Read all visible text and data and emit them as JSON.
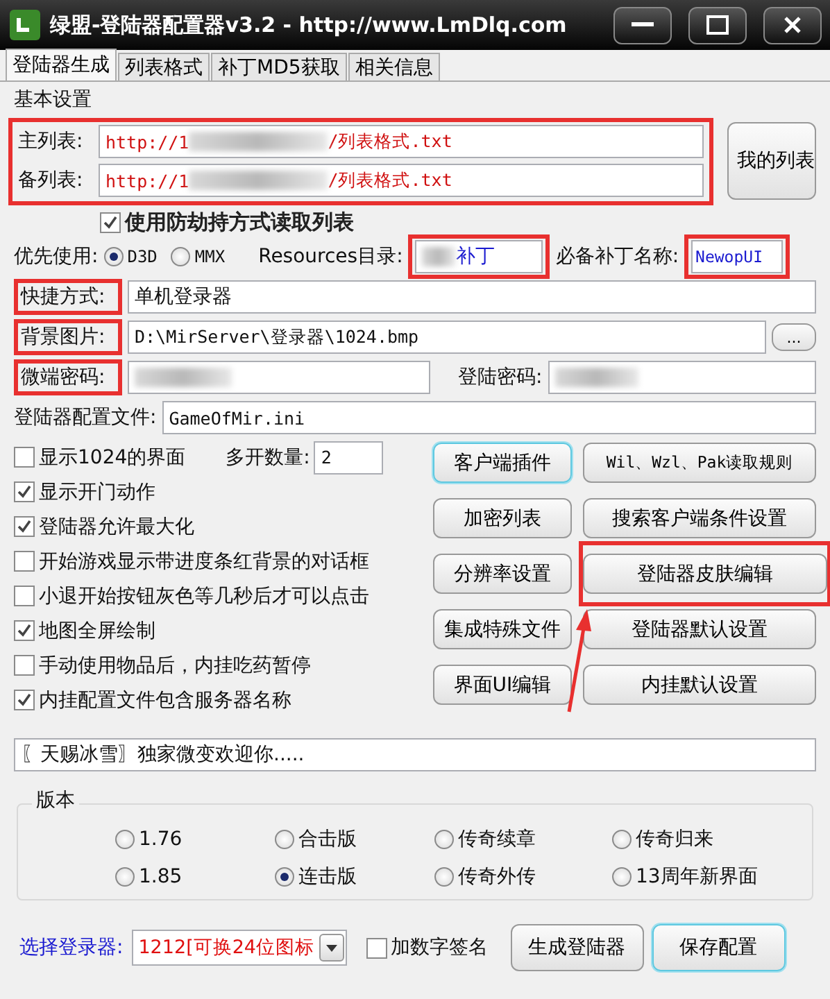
{
  "window": {
    "title": "绿盟-登陆器配置器v3.2 - http://www.LmDlq.com"
  },
  "tabs": [
    {
      "label": "登陆器生成",
      "selected": true
    },
    {
      "label": "列表格式",
      "selected": false
    },
    {
      "label": "补丁MD5获取",
      "selected": false
    },
    {
      "label": "相关信息",
      "selected": false
    }
  ],
  "basic": {
    "title": "基本设置",
    "main_list": {
      "label": "主列表:",
      "value_start": "http://1",
      "value_end": "/列表格式.txt"
    },
    "backup_list": {
      "label": "备列表:",
      "value_start": "http://1",
      "value_end": "/列表格式.txt"
    },
    "my_list_button": "我的列表",
    "anti_hijack": {
      "label": "使用防劫持方式读取列表",
      "checked": true
    },
    "prefer": {
      "label": "优先使用:",
      "options": [
        {
          "label": "D3D",
          "selected": true
        },
        {
          "label": "MMX",
          "selected": false
        }
      ]
    },
    "resources": {
      "label": "Resources目录:",
      "value_end": "补丁"
    },
    "patch_name": {
      "label": "必备补丁名称:",
      "value": "NewopUI"
    },
    "shortcut": {
      "label": "快捷方式:",
      "value": "单机登录器"
    },
    "background": {
      "label": "背景图片:",
      "value": "D:\\MirServer\\登录器\\1024.bmp",
      "browse": "..."
    },
    "micro_password": {
      "label": "微端密码:"
    },
    "login_password": {
      "label": "登陆密码:"
    },
    "config_file": {
      "label": "登陆器配置文件:",
      "value": "GameOfMir.ini"
    }
  },
  "options": [
    {
      "label": "显示1024的界面",
      "checked": false
    },
    {
      "label": "显示开门动作",
      "checked": true
    },
    {
      "label": "登陆器允许最大化",
      "checked": true
    },
    {
      "label": "开始游戏显示带进度条红背景的对话框",
      "checked": false
    },
    {
      "label": "小退开始按钮灰色等几秒后才可以点击",
      "checked": false
    },
    {
      "label": "地图全屏绘制",
      "checked": true
    },
    {
      "label": "手动使用物品后，内挂吃药暂停",
      "checked": false
    },
    {
      "label": "内挂配置文件包含服务器名称",
      "checked": true
    }
  ],
  "multi_open": {
    "label": "多开数量:",
    "value": "2"
  },
  "buttons": [
    {
      "label": "客户端插件",
      "focused": true
    },
    {
      "label": "Wil、Wzl、Pak读取规则",
      "focused": false
    },
    {
      "label": "加密列表",
      "focused": false
    },
    {
      "label": "搜索客户端条件设置",
      "focused": false
    },
    {
      "label": "分辨率设置",
      "focused": false
    },
    {
      "label": "登陆器皮肤编辑",
      "focused": false
    },
    {
      "label": "集成特殊文件",
      "focused": false
    },
    {
      "label": "登陆器默认设置",
      "focused": false
    },
    {
      "label": "界面UI编辑",
      "focused": false
    },
    {
      "label": "内挂默认设置",
      "focused": false
    }
  ],
  "notice": "〖天赐冰雪〗独家微变欢迎你.....",
  "version": {
    "title": "版本",
    "options": [
      {
        "label": "1.76",
        "selected": false
      },
      {
        "label": "合击版",
        "selected": false
      },
      {
        "label": "传奇续章",
        "selected": false
      },
      {
        "label": "传奇归来",
        "selected": false
      },
      {
        "label": "1.85",
        "selected": false
      },
      {
        "label": "连击版",
        "selected": true
      },
      {
        "label": "传奇外传",
        "selected": false
      },
      {
        "label": "13周年新界面",
        "selected": false
      }
    ]
  },
  "footer": {
    "select_label": "选择登录器:",
    "select_value": "1212[可换24位图标",
    "signature": {
      "label": "加数字签名",
      "checked": false
    },
    "actions": [
      {
        "label": "生成登陆器",
        "focused": false
      },
      {
        "label": "保存配置",
        "focused": true
      }
    ]
  }
}
